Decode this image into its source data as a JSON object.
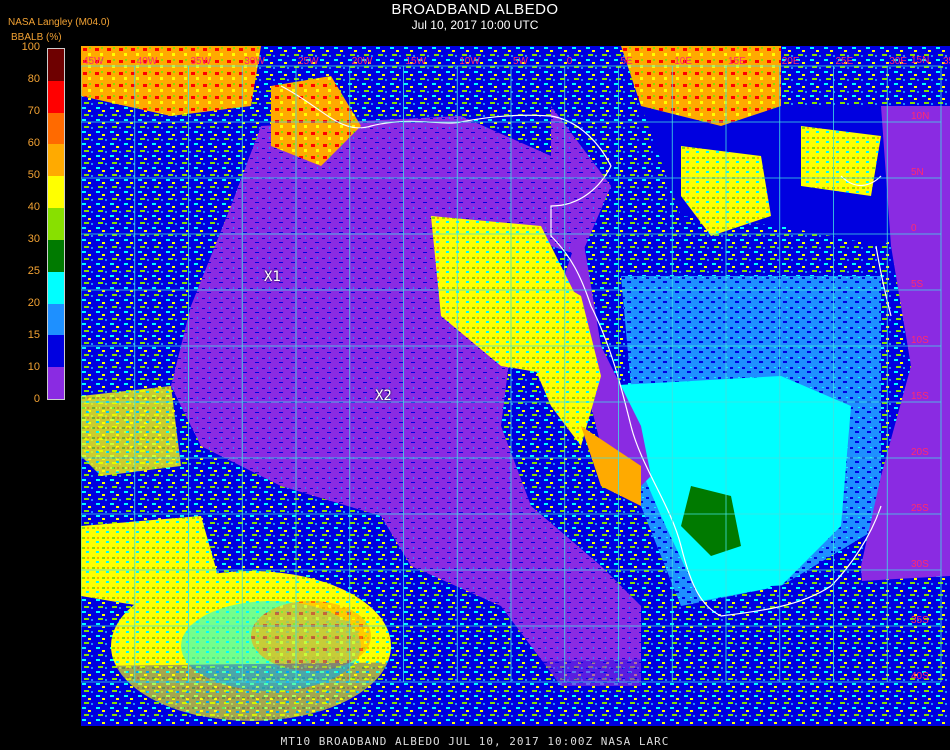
{
  "header": {
    "title": "BROADBAND ALBEDO",
    "subtitle": "Jul 10, 2017 10:00 UTC",
    "org": "NASA Langley (M04.0)",
    "unit": "BBALB (%)"
  },
  "legend": {
    "ticks": [
      "100",
      "80",
      "70",
      "60",
      "50",
      "40",
      "30",
      "25",
      "20",
      "15",
      "10",
      "0"
    ],
    "colors": [
      "#6e0000",
      "#ff0000",
      "#ff6a00",
      "#ffaa00",
      "#ffff00",
      "#88e000",
      "#007a00",
      "#00ffff",
      "#1e90ff",
      "#0000e0",
      "#8a2be2"
    ]
  },
  "map": {
    "grid_color": "#40e0e0",
    "markers": [
      {
        "label": "X1"
      },
      {
        "label": "X2"
      }
    ],
    "top_lon_labels": [
      "45W",
      "40W",
      "35W",
      "30W",
      "25W",
      "20W",
      "15W",
      "10W",
      "5W",
      "0",
      "5E",
      "10E",
      "15E",
      "20E",
      "25E",
      "30E",
      "35E"
    ],
    "right_lat_labels": [
      "15N",
      "10N",
      "5N",
      "0",
      "5S",
      "10S",
      "15S",
      "20S",
      "25S",
      "30S",
      "35S",
      "40S"
    ]
  },
  "footer": {
    "text": "MT10  BROADBAND ALBEDO   JUL 10, 2017 10:00Z   NASA LARC"
  }
}
